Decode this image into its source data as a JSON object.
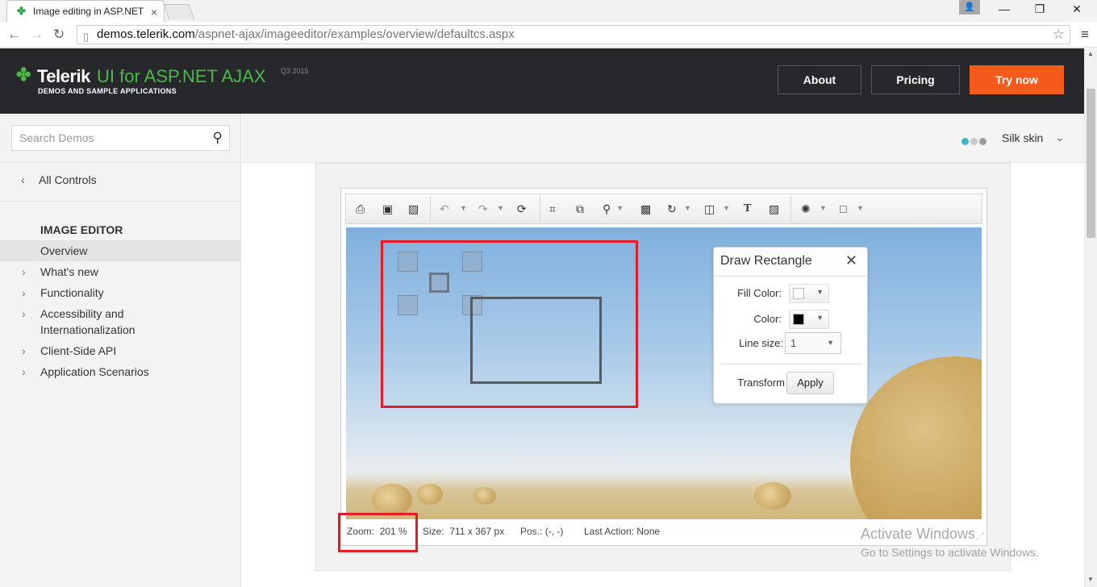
{
  "browser": {
    "tab_title": "Image editing in ASP.NET",
    "url_host": "demos.telerik.com",
    "url_path": "/aspnet-ajax/imageeditor/examples/overview/defaultcs.aspx"
  },
  "header": {
    "logo_brand": "Telerik",
    "logo_product": "UI for ASP.NET AJAX",
    "logo_version": "Q3 2015",
    "logo_subtitle": "DEMOS AND SAMPLE APPLICATIONS",
    "about": "About",
    "pricing": "Pricing",
    "try_now": "Try now",
    "accent_color": "#f45a1c",
    "brand_color": "#4cb848"
  },
  "sidebar": {
    "search_placeholder": "Search Demos",
    "all_controls": "All Controls",
    "section_title": "IMAGE EDITOR",
    "items": [
      {
        "label": "Overview",
        "active": true
      },
      {
        "label": "What's new"
      },
      {
        "label": "Functionality"
      },
      {
        "label": "Accessibility and"
      },
      {
        "label": "Internationalization"
      },
      {
        "label": "Client-Side API"
      },
      {
        "label": "Application Scenarios"
      }
    ]
  },
  "skin": {
    "label": "Silk skin",
    "dot_colors": [
      "#3eb6c8",
      "#c9c9c9",
      "#9a9a9a"
    ]
  },
  "toolbar_icons": [
    "print-icon",
    "save-icon",
    "image-icon",
    "undo-icon",
    "redo-icon",
    "reset-icon",
    "crop-icon",
    "resize-icon",
    "zoom-icon",
    "opacity-icon",
    "rotate-icon",
    "flip-icon",
    "text-icon",
    "insert-image-icon",
    "effects-icon",
    "shape-icon"
  ],
  "dialog": {
    "title": "Draw Rectangle",
    "fill_color_label": "Fill Color:",
    "color_label": "Color:",
    "line_size_label": "Line size:",
    "line_size_value": "1",
    "transform_label": "Transform",
    "apply": "Apply",
    "fill_color": "#ffffff",
    "stroke_color": "#000000"
  },
  "status": {
    "zoom_label": "Zoom:",
    "zoom_value": "201 %",
    "size_label": "Size:",
    "size_value": "711 x 367 px",
    "pos_label": "Pos.:",
    "pos_value": "(-, -)",
    "last_action_label": "Last Action:",
    "last_action_value": "None"
  },
  "watermark": {
    "line1": "Activate Windows",
    "line2": "Go to Settings to activate Windows."
  }
}
